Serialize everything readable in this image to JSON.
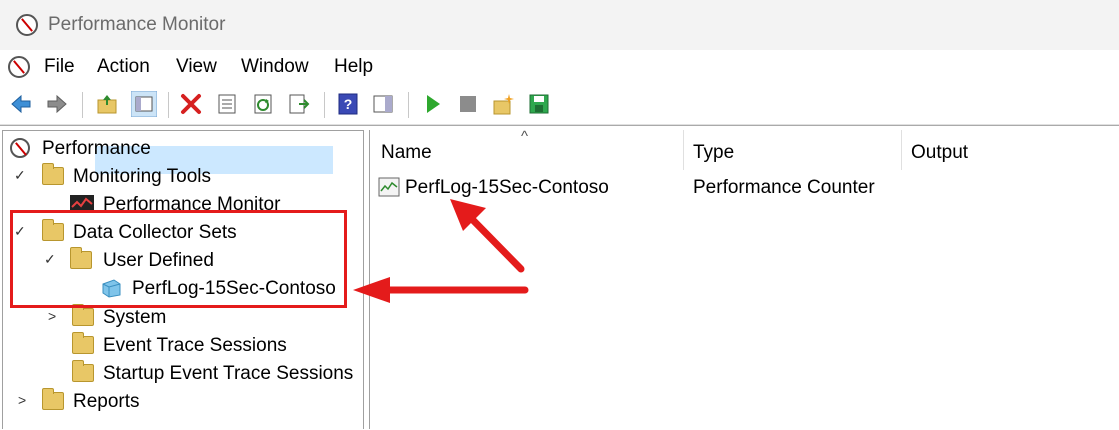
{
  "window": {
    "title": "Performance Monitor"
  },
  "menu": [
    "File",
    "Action",
    "View",
    "Window",
    "Help"
  ],
  "toolbar": {
    "icons": [
      "back-icon",
      "forward-icon",
      "up-folder-icon",
      "show-hide-tree-icon",
      "delete-icon",
      "properties-icon",
      "refresh-icon",
      "export-list-icon",
      "help-icon",
      "show-hide-action-icon",
      "start-icon",
      "stop-icon",
      "new-item-icon",
      "save-icon"
    ]
  },
  "tree": {
    "root": "Performance",
    "monitoring_tools": "Monitoring Tools",
    "performance_monitor": "Performance Monitor",
    "data_collector_sets": "Data Collector Sets",
    "user_defined": "User Defined",
    "perflog": "PerfLog-15Sec-Contoso",
    "system": "System",
    "event_trace": "Event Trace Sessions",
    "startup_event_trace": "Startup Event Trace Sessions",
    "reports": "Reports"
  },
  "list": {
    "sort_indicator": "^",
    "columns": [
      "Name",
      "Type",
      "Output"
    ],
    "rows": [
      {
        "name": "PerfLog-15Sec-Contoso",
        "type": "Performance Counter",
        "output": ""
      }
    ]
  },
  "annotation_color": "#e41b1b",
  "selection_color": "#cce8ff"
}
